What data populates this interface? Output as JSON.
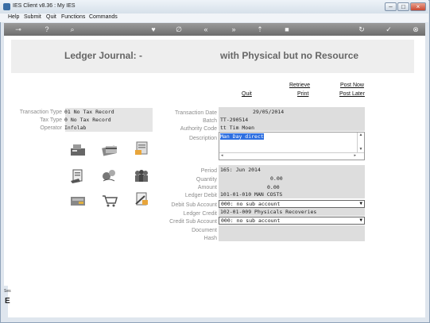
{
  "window": {
    "title": "IES Client v8.36 : My IES"
  },
  "menu": [
    "Help",
    "Submit",
    "Quit",
    "Functions",
    "Commands"
  ],
  "toolbar_icons": [
    "key-icon",
    "help-icon",
    "search-icon",
    "heart-icon",
    "clip-icon",
    "rewind-icon",
    "forward-icon",
    "upload-icon",
    "stop-icon",
    "refresh-icon",
    "check-icon",
    "close-icon"
  ],
  "page": {
    "title_left": "Ledger Journal: -",
    "title_right": "with Physical but no Resource"
  },
  "links": {
    "retrieve": "Retrieve",
    "post_now": "Post Now",
    "quit": "Quit",
    "print": "Print",
    "post_later": "Post Later"
  },
  "left_fields": [
    {
      "label": "Transaction Type",
      "value": "01 No Tax Record"
    },
    {
      "label": "Tax Type",
      "value": "0 No Tax Record"
    },
    {
      "label": "Operator",
      "value": "Infolab"
    }
  ],
  "form": {
    "transaction_date": {
      "label": "Transaction Date",
      "value": "29/05/2014"
    },
    "batch": {
      "label": "Batch",
      "value": "TT-290514"
    },
    "authority_code": {
      "label": "Authority Code",
      "value": "tt Tim Moen"
    },
    "description": {
      "label": "Description",
      "value": "Man Day direct"
    },
    "period": {
      "label": "Period",
      "value": "165: Jun 2014"
    },
    "quantity": {
      "label": "Quantity",
      "value": "0.00"
    },
    "amount": {
      "label": "Amount",
      "value": "0.00"
    },
    "ledger_debit": {
      "label": "Ledger Debit",
      "value": "101-01-010 MAN COSTS"
    },
    "debit_sub_account": {
      "label": "Debit Sub Account",
      "value": "000: no sub account"
    },
    "ledger_credit": {
      "label": "Ledger Credit",
      "value": "102-01-009 Physicals Recoveries"
    },
    "credit_sub_account": {
      "label": "Credit Sub Account",
      "value": "000: no sub account"
    },
    "document": {
      "label": "Document",
      "value": ""
    },
    "hash": {
      "label": "Hash",
      "value": ""
    }
  },
  "status": {
    "side_text": "Ses",
    "side_letter": "E"
  },
  "colors": {
    "accent": "#2e6fe0",
    "toolbar": "#7a7a7a",
    "band": "#eeeeee"
  }
}
